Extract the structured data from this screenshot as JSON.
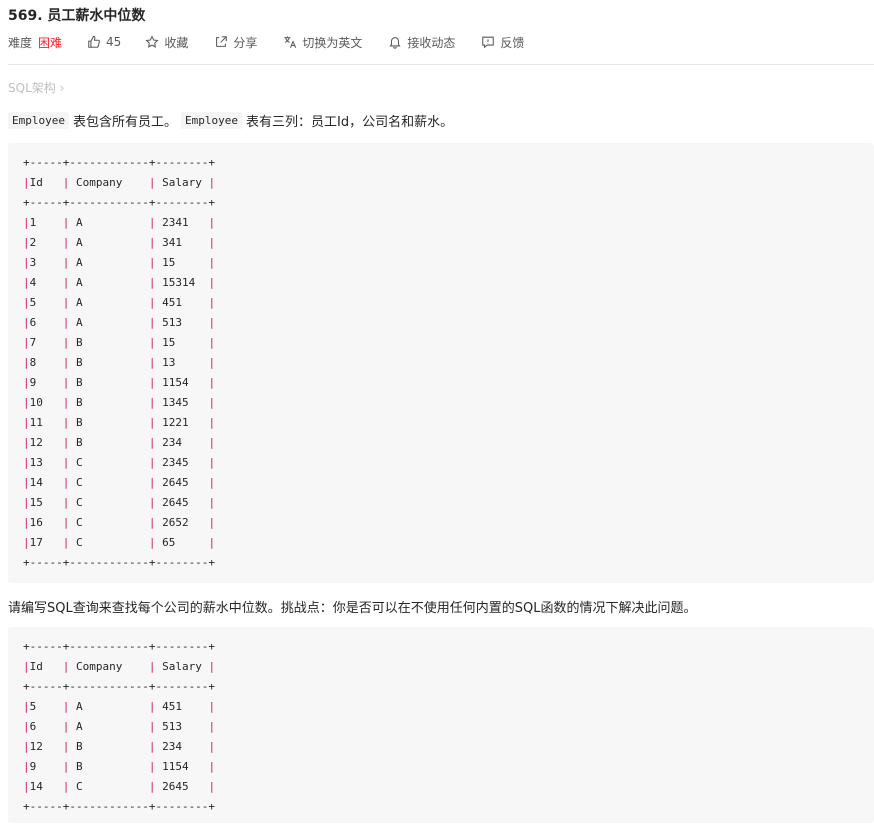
{
  "header": {
    "title": "569. 员工薪水中位数",
    "difficulty_label": "难度",
    "difficulty": "困难",
    "likes": "45",
    "favorite": "收藏",
    "share": "分享",
    "switch_lang": "切换为英文",
    "subscribe": "接收动态",
    "feedback": "反馈"
  },
  "breadcrumb": "SQL架构 ›",
  "description": {
    "table_name_1": "Employee",
    "text_1": "表包含所有员工。",
    "table_name_2": "Employee",
    "text_2": "表有三列：员工Id，公司名和薪水。",
    "question": "请编写SQL查询来查找每个公司的薪水中位数。挑战点：你是否可以在不使用任何内置的SQL函数的情况下解决此问题。"
  },
  "input_table": {
    "border": "+-----+------------+--------+",
    "headers": [
      "Id",
      "Company",
      "Salary"
    ],
    "rows": [
      [
        "1",
        "A",
        "2341"
      ],
      [
        "2",
        "A",
        "341"
      ],
      [
        "3",
        "A",
        "15"
      ],
      [
        "4",
        "A",
        "15314"
      ],
      [
        "5",
        "A",
        "451"
      ],
      [
        "6",
        "A",
        "513"
      ],
      [
        "7",
        "B",
        "15"
      ],
      [
        "8",
        "B",
        "13"
      ],
      [
        "9",
        "B",
        "1154"
      ],
      [
        "10",
        "B",
        "1345"
      ],
      [
        "11",
        "B",
        "1221"
      ],
      [
        "12",
        "B",
        "234"
      ],
      [
        "13",
        "C",
        "2345"
      ],
      [
        "14",
        "C",
        "2645"
      ],
      [
        "15",
        "C",
        "2645"
      ],
      [
        "16",
        "C",
        "2652"
      ],
      [
        "17",
        "C",
        "65"
      ]
    ]
  },
  "output_table": {
    "border": "+-----+------------+--------+",
    "headers": [
      "Id",
      "Company",
      "Salary"
    ],
    "rows": [
      [
        "5",
        "A",
        "451"
      ],
      [
        "6",
        "A",
        "513"
      ],
      [
        "12",
        "B",
        "234"
      ],
      [
        "9",
        "B",
        "1154"
      ],
      [
        "14",
        "C",
        "2645"
      ]
    ]
  },
  "colors": {
    "difficulty_hard": "#f5222d",
    "pipe": "#c7254e",
    "code_bg": "#f7f7f7"
  }
}
